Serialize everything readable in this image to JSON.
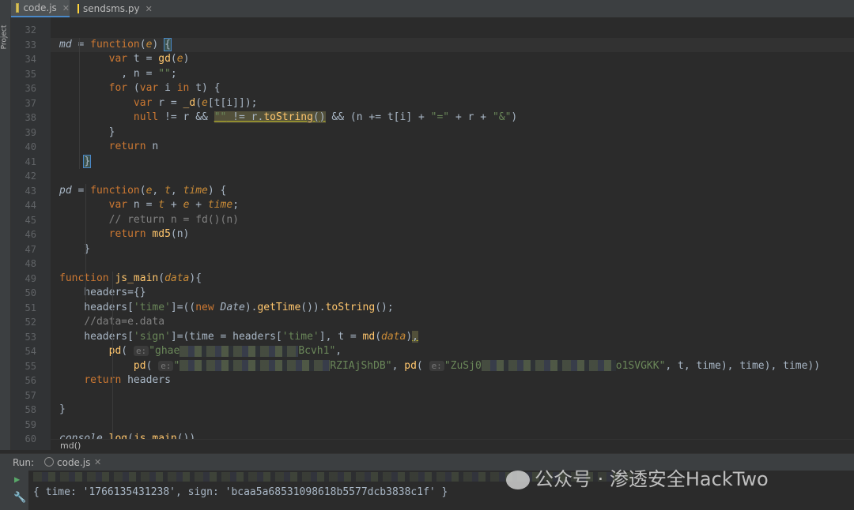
{
  "tabs": [
    {
      "label": "code.js",
      "active": true
    },
    {
      "label": "sendsms.py",
      "active": false
    }
  ],
  "sidebar": {
    "project_label": "Project"
  },
  "editor": {
    "lines": [
      {
        "n": "32",
        "html": ""
      },
      {
        "n": "33",
        "html": "<span class=\"it\">md</span> = <span class=\"kw\">function</span>(<span class=\"par\">e</span>) <span class=\"brace\">{</span>"
      },
      {
        "n": "34",
        "html": "        <span class=\"kw\">var</span> t = <span class=\"fn\">gd</span>(<span class=\"par\">e</span>)"
      },
      {
        "n": "35",
        "html": "          , n = <span class=\"str\">\"\"</span>;"
      },
      {
        "n": "36",
        "html": "        <span class=\"kw\">for</span> (<span class=\"kw\">var</span> i <span class=\"kw\">in</span> t) {"
      },
      {
        "n": "37",
        "html": "            <span class=\"kw\">var</span> r = <span class=\"fn\">_d</span>(<span class=\"par\">e</span>[t[i]]);"
      },
      {
        "n": "38",
        "html": "            <span class=\"kw\">null</span> != r &amp;&amp; <span class=\"warn\"><span class=\"str\">\"\"</span> != r.<span class=\"fn\">toString</span>()</span> &amp;&amp; (n += t[i] + <span class=\"str\">\"=\"</span> + r + <span class=\"str\">\"&amp;\"</span>)"
      },
      {
        "n": "39",
        "html": "        }"
      },
      {
        "n": "40",
        "html": "        <span class=\"kw\">return</span> n"
      },
      {
        "n": "41",
        "html": "    <span class=\"brace\">}</span>"
      },
      {
        "n": "42",
        "html": ""
      },
      {
        "n": "43",
        "html": "<span class=\"it\">pd</span> = <span class=\"kw\">function</span>(<span class=\"par\">e</span>, <span class=\"par\">t</span>, <span class=\"par\">time</span>) {"
      },
      {
        "n": "44",
        "html": "        <span class=\"kw\">var</span> n = <span class=\"par\">t</span> + <span class=\"par\">e</span> + <span class=\"par\">time</span>;"
      },
      {
        "n": "45",
        "html": "        <span class=\"cmt\">// return n = fd()(n)</span>"
      },
      {
        "n": "46",
        "html": "        <span class=\"kw\">return</span> <span class=\"fn\">md5</span>(n)"
      },
      {
        "n": "47",
        "html": "    }"
      },
      {
        "n": "48",
        "html": ""
      },
      {
        "n": "49",
        "html": "<span class=\"kw\">function</span> <span class=\"fn\">js_main</span>(<span class=\"par\">data</span>){"
      },
      {
        "n": "50",
        "html": "    headers={}"
      },
      {
        "n": "51",
        "html": "    headers[<span class=\"str\">'time'</span>]=((<span class=\"kw\">new</span> <span class=\"it\">Date</span>).<span class=\"fn\">getTime</span>()).<span class=\"fn\">toString</span>();"
      },
      {
        "n": "52",
        "html": "    <span class=\"cmt\">//data=e.data</span>"
      },
      {
        "n": "53",
        "html": "    headers[<span class=\"str\">'sign'</span>]=(time = headers[<span class=\"str\">'time'</span>], t = <span class=\"fn\">md</span>(<span class=\"par\">data</span>)<span class=\"warn\">,</span>"
      },
      {
        "n": "54",
        "html": "        <span class=\"fn\">pd</span>( <span class=\"hint\">e:</span><span class=\"str\">\"ghae</span><span class=\"blur\" style=\"width:150px\"></span><span class=\"str\">Bcvh1\"</span>,"
      },
      {
        "n": "55",
        "html": "            <span class=\"fn\">pd</span>( <span class=\"hint\">e:</span><span class=\"str\">\"</span><span class=\"blur\" style=\"width:190px\"></span><span class=\"str\">RZIAjShDB\"</span>, <span class=\"fn\">pd</span>( <span class=\"hint\">e:</span><span class=\"str\">\"ZuSj0</span><span class=\"blur\" style=\"width:170px\"></span><span class=\"str\">o1SVGKK\"</span>, t, time), time), time))"
      },
      {
        "n": "56",
        "html": "    <span class=\"kw\">return</span> headers"
      },
      {
        "n": "57",
        "html": ""
      },
      {
        "n": "58",
        "html": "}"
      },
      {
        "n": "59",
        "html": ""
      },
      {
        "n": "60",
        "html": "<span class=\"it\">console</span>.<span class=\"fn\">log</span>(<span class=\"fn\">js_main</span>())"
      }
    ]
  },
  "breadcrumb": {
    "text": "md()"
  },
  "run": {
    "label": "Run:",
    "config": "code.js"
  },
  "console": {
    "output": "{ time: '1766135431238', sign: 'bcaa5a68531098618b5577dcb3838c1f' }"
  },
  "watermark": {
    "text": "公众号 · 渗透安全HackTwo"
  }
}
